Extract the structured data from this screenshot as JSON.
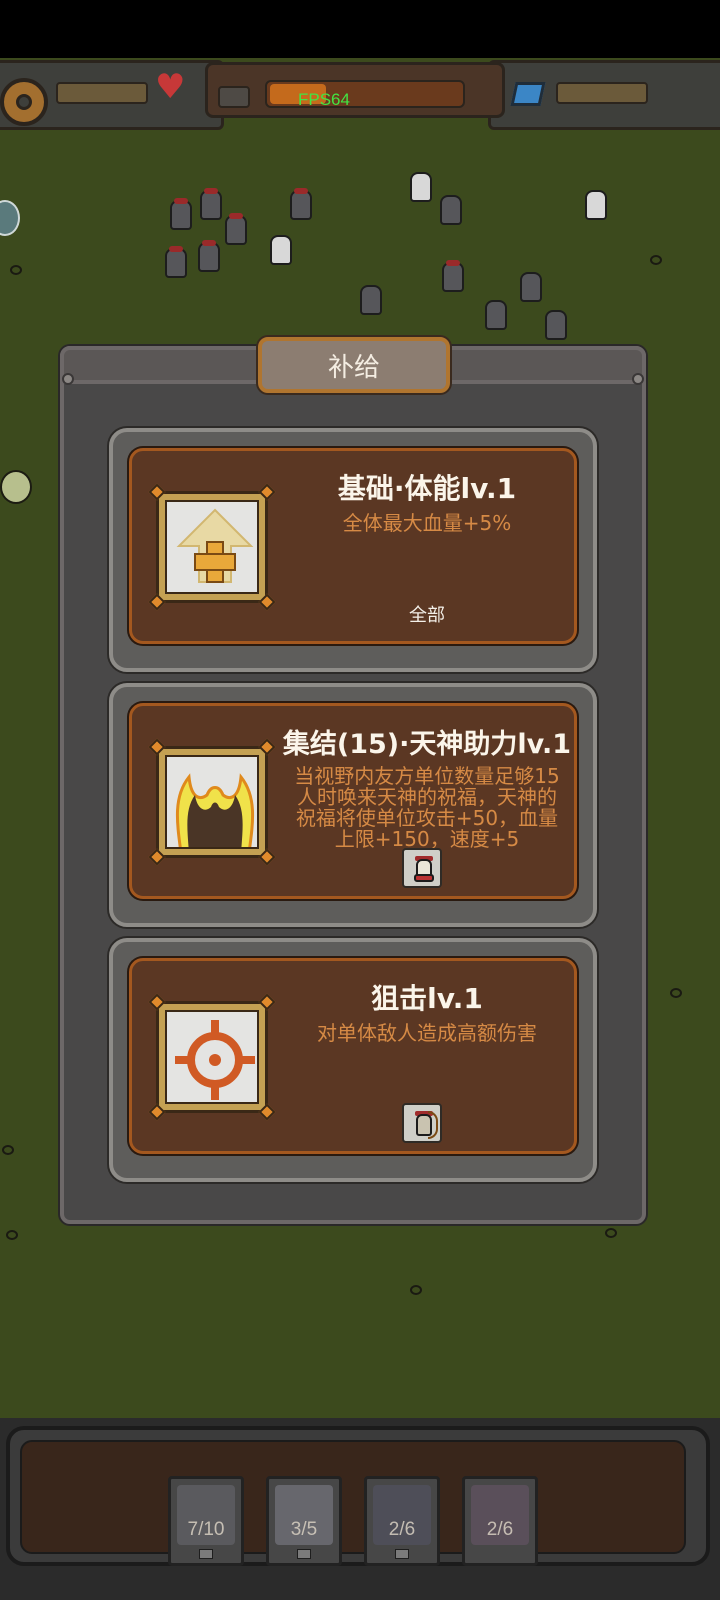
{
  "hud": {
    "fps_label": "FPS64",
    "settings_icon": "gear-icon",
    "health_icon": "heart-icon",
    "gem_icon": "gem-icon"
  },
  "dialog": {
    "title": "补给",
    "cards": [
      {
        "title": "基础·体能lv.1",
        "desc_lines": [
          "全体最大血量+5%"
        ],
        "tag": "全部",
        "icon": "arrow-up-plus-icon"
      },
      {
        "title": "集结(15)·天神助力lv.1",
        "desc_lines": [
          "当视野内友方单位数量足够15",
          "人时唤来天神的祝福，天神的",
          "祝福将使单位攻击+50，血量",
          "上限+150，速度+5"
        ],
        "tag_icon": "drummer-unit-icon",
        "icon": "flaming-silhouette-icon"
      },
      {
        "title": "狙击lv.1",
        "desc_lines": [
          "对单体敌人造成高额伤害"
        ],
        "tag_icon": "archer-unit-icon",
        "icon": "crosshair-icon"
      }
    ]
  },
  "army_slots": [
    {
      "count": "7/10",
      "icon": "archer-unit-icon"
    },
    {
      "count": "3/5",
      "icon": "drummer-unit-icon"
    },
    {
      "count": "2/6",
      "icon": "horned-warrior-icon"
    },
    {
      "count": "2/6",
      "icon": "cavalry-unit-icon"
    }
  ],
  "colors": {
    "card_bg": "#5b3723",
    "card_border": "#a4581f",
    "desc_text": "#d68a45",
    "fps_text": "#42e442",
    "grass": "#3c4a1d"
  }
}
